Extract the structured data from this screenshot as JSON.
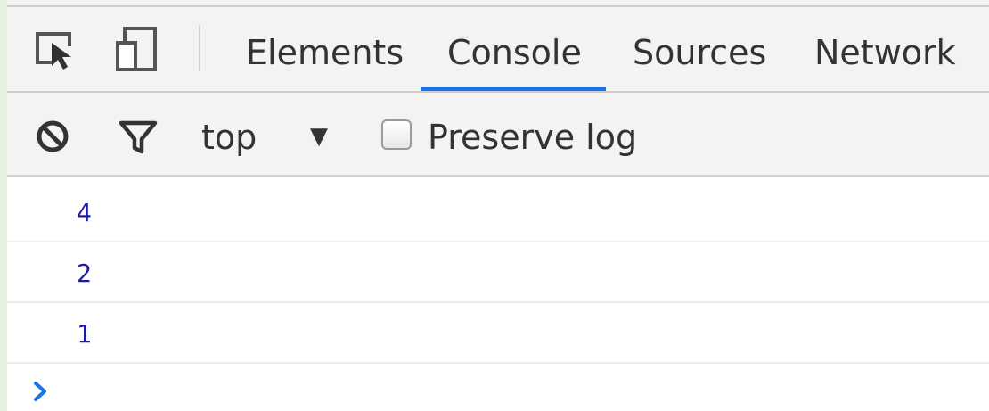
{
  "toolbar": {
    "inspect_icon": "inspect-element-icon",
    "device_icon": "device-toggle-icon"
  },
  "tabs": [
    {
      "label": "Elements",
      "active": false
    },
    {
      "label": "Console",
      "active": true
    },
    {
      "label": "Sources",
      "active": false
    },
    {
      "label": "Network",
      "active": false
    }
  ],
  "filter": {
    "clear_icon": "clear-console-icon",
    "filter_icon": "filter-icon",
    "context": "top",
    "context_arrow": "▼",
    "preserve_log_label": "Preserve log",
    "preserve_log_checked": false
  },
  "console": {
    "messages": [
      "4",
      "2",
      "1"
    ],
    "prompt_icon": "prompt-chevron-icon"
  },
  "colors": {
    "accent": "#1a73e8",
    "number": "#1a1aa6",
    "toolbar_bg": "#f3f3f3"
  }
}
